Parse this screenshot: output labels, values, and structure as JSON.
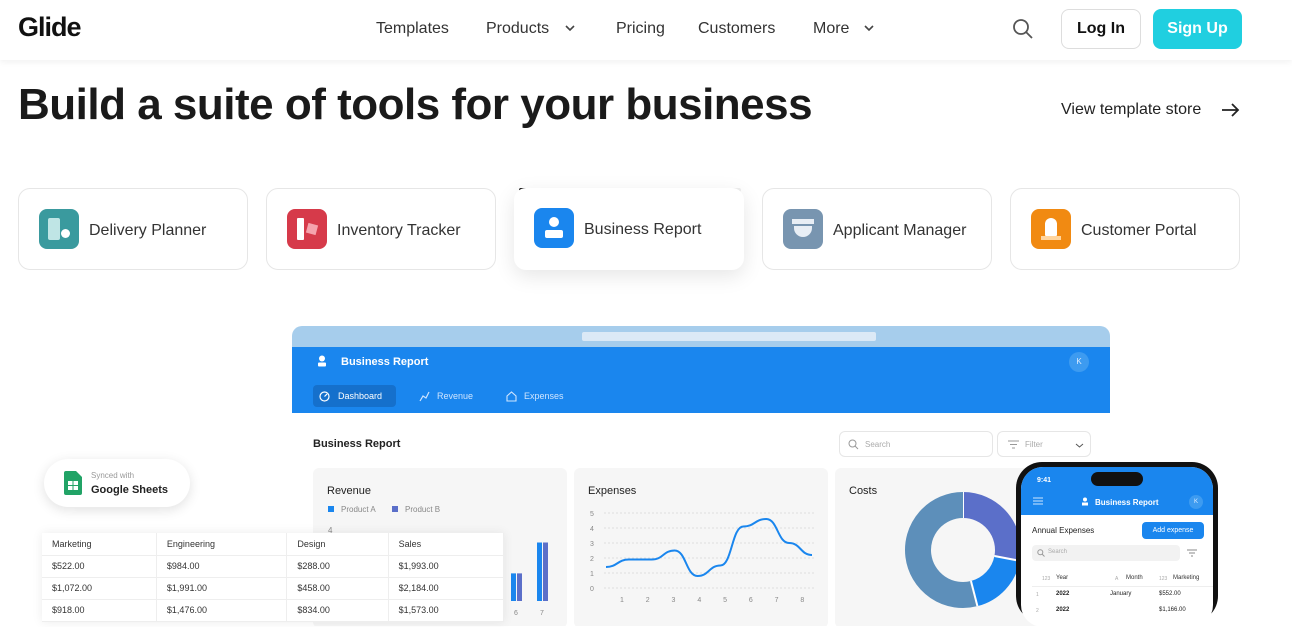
{
  "nav": {
    "logo": "Glide",
    "links": [
      "Templates",
      "Products",
      "Pricing",
      "Customers",
      "More"
    ],
    "login": "Log In",
    "signup": "Sign Up"
  },
  "hero": {
    "title": "Build a suite of tools for your business",
    "store_link": "View template store"
  },
  "templates": [
    {
      "label": "Delivery Planner",
      "color": "#3a9a9e"
    },
    {
      "label": "Inventory Tracker",
      "color": "#d63a4a"
    },
    {
      "label": "Business Report",
      "color": "#1a86ee"
    },
    {
      "label": "Applicant Manager",
      "color": "#7895b0"
    },
    {
      "label": "Customer Portal",
      "color": "#f18a12"
    }
  ],
  "sheets": {
    "synced": "Synced with",
    "name": "Google Sheets",
    "headers": [
      "Marketing",
      "Engineering",
      "Design",
      "Sales"
    ],
    "rows": [
      [
        "$522.00",
        "$984.00",
        "$288.00",
        "$1,993.00"
      ],
      [
        "$1,072.00",
        "$1,991.00",
        "$458.00",
        "$2,184.00"
      ],
      [
        "$918.00",
        "$1,476.00",
        "$834.00",
        "$1,573.00"
      ]
    ]
  },
  "app": {
    "title": "Business Report",
    "avatar": "K",
    "tabs": [
      "Dashboard",
      "Revenue",
      "Expenses"
    ],
    "page_title": "Business Report",
    "search": "Search",
    "filter": "Filter",
    "revenue": {
      "title": "Revenue",
      "legend": [
        "Product A",
        "Product B"
      ]
    },
    "expenses": {
      "title": "Expenses"
    },
    "costs": {
      "title": "Costs"
    }
  },
  "phone": {
    "time": "9:41",
    "title": "Business Report",
    "avatar": "K",
    "section": "Annual Expenses",
    "add": "Add expense",
    "search": "Search",
    "cols": [
      "Year",
      "Month",
      "Marketing"
    ],
    "col_tags": [
      "123",
      "A",
      "123"
    ],
    "rows": [
      [
        "1",
        "2022",
        "January",
        "$552.00"
      ],
      [
        "2",
        "2022",
        "",
        "$1,166.00"
      ]
    ]
  },
  "chart_data": {
    "type": "line",
    "title": "Expenses",
    "x": [
      1,
      2,
      3,
      4,
      5,
      6,
      7,
      8
    ],
    "values": [
      1.4,
      1.9,
      1.9,
      2.5,
      0.8,
      1.5,
      4.1,
      4.6,
      3,
      2.2
    ],
    "ylim": [
      0,
      5
    ],
    "yticks": [
      0,
      1,
      2,
      3,
      4,
      5
    ],
    "xticks": [
      1,
      2,
      3,
      4,
      5,
      6,
      7,
      8
    ]
  },
  "bar_data": {
    "type": "bar",
    "title": "Revenue",
    "categories": [
      "6",
      "7"
    ],
    "series": [
      {
        "name": "Product A",
        "values": [
          1.7,
          3.6
        ]
      },
      {
        "name": "Product B",
        "values": [
          1.7,
          3.6
        ]
      }
    ],
    "ytick": "4"
  },
  "donut_data": {
    "type": "pie",
    "title": "Costs",
    "values": [
      28,
      18,
      54
    ],
    "colors": [
      "#5b6fc9",
      "#1a86ee",
      "#5d8fba"
    ]
  }
}
